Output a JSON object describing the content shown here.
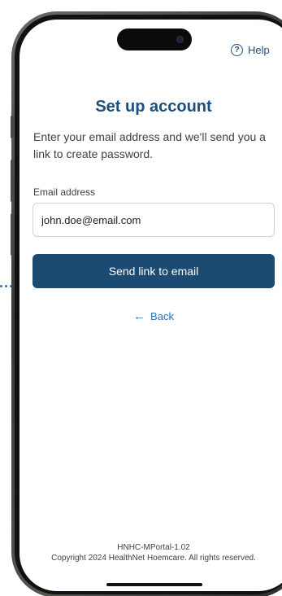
{
  "header": {
    "help_label": "Help",
    "help_icon": "question-circle-icon"
  },
  "main": {
    "title": "Set up account",
    "instructions": "Enter your email address and we'll send you a link to create password.",
    "email_label": "Email address",
    "email_value": "john.doe@email.com",
    "send_button_label": "Send link to email",
    "back_label": "Back",
    "back_icon": "arrow-left-icon"
  },
  "footer": {
    "version": "HNHC-MPortal-1.02",
    "copyright": "Copyright 2024 HealthNet Hoemcare. All rights reserved."
  },
  "colors": {
    "brand_primary": "#1b4a72",
    "title": "#1d4f7c",
    "link": "#2a6fb5",
    "text": "#3b3f45",
    "input_border": "#cdd2d8"
  }
}
